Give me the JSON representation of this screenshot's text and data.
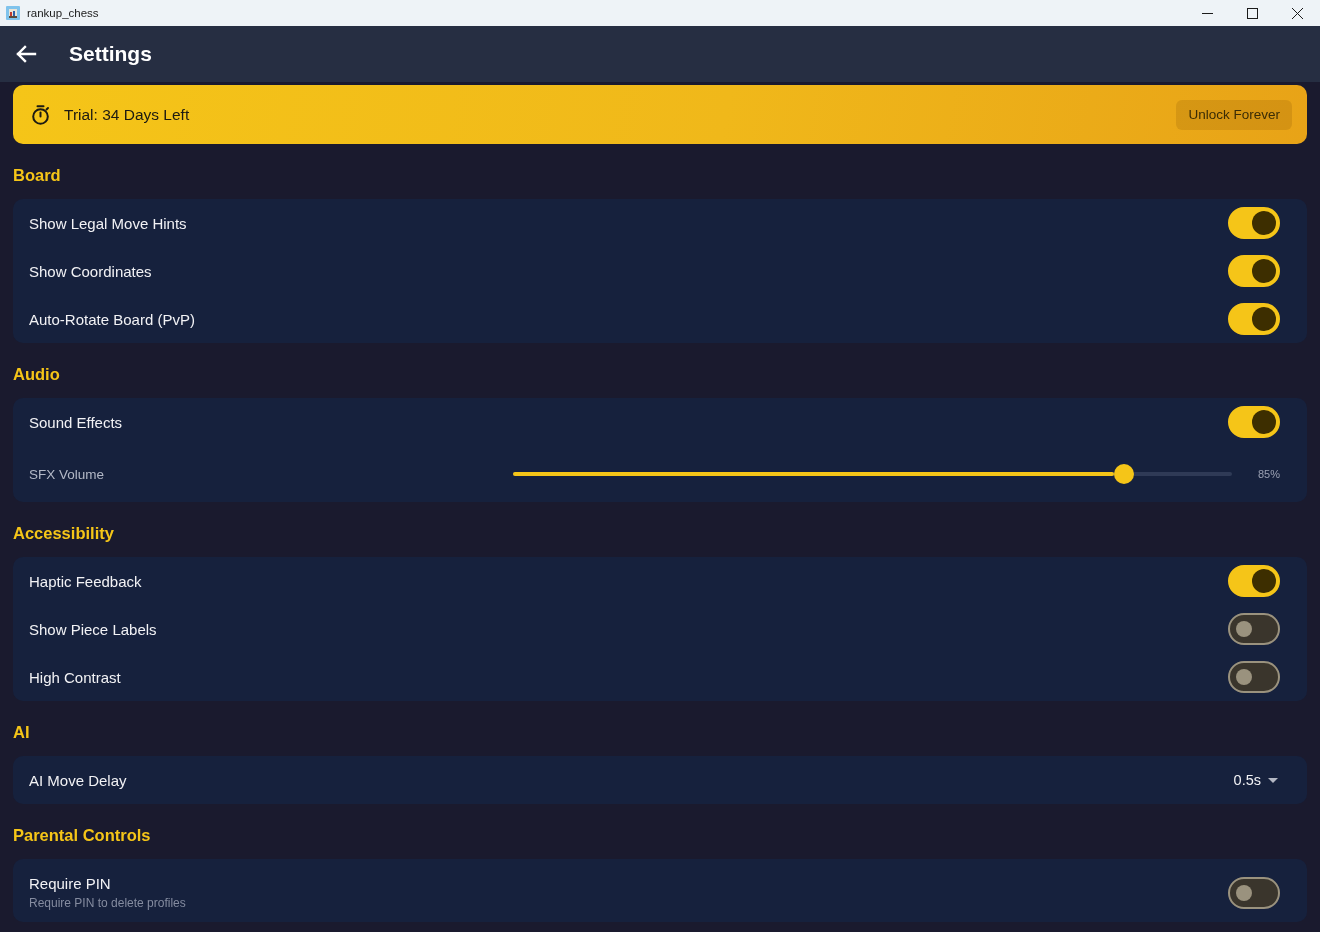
{
  "window": {
    "title": "rankup_chess"
  },
  "app_bar": {
    "title": "Settings"
  },
  "trial_banner": {
    "text": "Trial: 34 Days Left",
    "button": "Unlock Forever"
  },
  "sections": [
    {
      "title": "Board",
      "items": [
        {
          "kind": "toggle",
          "label": "Show Legal Move Hints",
          "on": true
        },
        {
          "kind": "toggle",
          "label": "Show Coordinates",
          "on": true
        },
        {
          "kind": "toggle",
          "label": "Auto-Rotate Board (PvP)",
          "on": true
        }
      ]
    },
    {
      "title": "Audio",
      "items": [
        {
          "kind": "toggle",
          "label": "Sound Effects",
          "on": true
        },
        {
          "kind": "slider",
          "label": "SFX Volume",
          "level": 0.85,
          "reading": "85%"
        }
      ]
    },
    {
      "title": "Accessibility",
      "items": [
        {
          "kind": "toggle",
          "label": "Haptic Feedback",
          "on": true
        },
        {
          "kind": "toggle",
          "label": "Show Piece Labels",
          "on": false
        },
        {
          "kind": "toggle",
          "label": "High Contrast",
          "on": false
        }
      ]
    },
    {
      "title": "AI",
      "items": [
        {
          "kind": "dropdown",
          "label": "AI Move Delay",
          "value": "0.5s"
        }
      ]
    },
    {
      "title": "Parental Controls",
      "items": [
        {
          "kind": "toggle",
          "label": "Require PIN",
          "subtitle": "Require PIN to delete profiles",
          "on": false
        }
      ]
    }
  ]
}
